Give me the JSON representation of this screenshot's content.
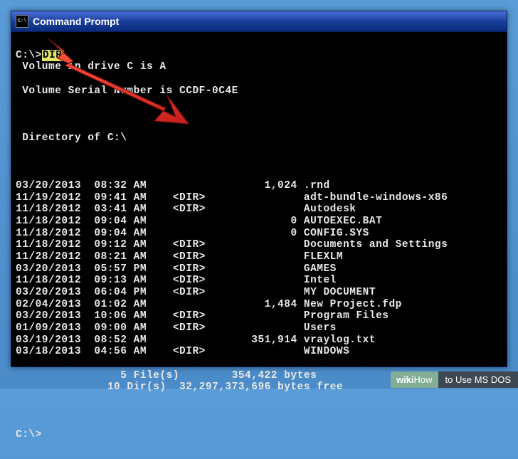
{
  "window": {
    "title": "Command Prompt",
    "icon_label": "C:\\"
  },
  "prompt": "C:\\>",
  "command": "DIR",
  "volume_line": "Volume in drive C is A",
  "serial_line": "Volume Serial Number is CCDF-0C4E",
  "directory_line": "Directory of C:\\",
  "entries": [
    {
      "date": "03/20/2013",
      "time": "08:32 AM",
      "dir": false,
      "size": "1,024",
      "name": ".rnd"
    },
    {
      "date": "11/19/2012",
      "time": "09:41 AM",
      "dir": true,
      "size": "",
      "name": "adt-bundle-windows-x86"
    },
    {
      "date": "11/18/2012",
      "time": "03:41 AM",
      "dir": true,
      "size": "",
      "name": "Autodesk"
    },
    {
      "date": "11/18/2012",
      "time": "09:04 AM",
      "dir": false,
      "size": "0",
      "name": "AUTOEXEC.BAT"
    },
    {
      "date": "11/18/2012",
      "time": "09:04 AM",
      "dir": false,
      "size": "0",
      "name": "CONFIG.SYS"
    },
    {
      "date": "11/18/2012",
      "time": "09:12 AM",
      "dir": true,
      "size": "",
      "name": "Documents and Settings"
    },
    {
      "date": "11/28/2012",
      "time": "08:21 AM",
      "dir": true,
      "size": "",
      "name": "FLEXLM"
    },
    {
      "date": "03/20/2013",
      "time": "05:57 PM",
      "dir": true,
      "size": "",
      "name": "GAMES"
    },
    {
      "date": "11/18/2012",
      "time": "09:13 AM",
      "dir": true,
      "size": "",
      "name": "Intel"
    },
    {
      "date": "03/20/2013",
      "time": "06:04 PM",
      "dir": true,
      "size": "",
      "name": "MY DOCUMENT"
    },
    {
      "date": "02/04/2013",
      "time": "01:02 AM",
      "dir": false,
      "size": "1,484",
      "name": "New Project.fdp"
    },
    {
      "date": "03/20/2013",
      "time": "10:06 AM",
      "dir": true,
      "size": "",
      "name": "Program Files"
    },
    {
      "date": "01/09/2013",
      "time": "09:00 AM",
      "dir": true,
      "size": "",
      "name": "Users"
    },
    {
      "date": "03/19/2013",
      "time": "08:52 AM",
      "dir": false,
      "size": "351,914",
      "name": "vraylog.txt"
    },
    {
      "date": "03/18/2013",
      "time": "04:56 AM",
      "dir": true,
      "size": "",
      "name": "WINDOWS"
    }
  ],
  "summary": {
    "files_count": "5",
    "files_label": "File(s)",
    "files_bytes": "354,422 bytes",
    "dirs_count": "10",
    "dirs_label": "Dir(s)",
    "dirs_bytes": "32,297,373,696 bytes free"
  },
  "end_prompt": "C:\\>",
  "watermark": {
    "brand_bold": "wiki",
    "brand_rest": "How",
    "caption": "to Use MS DOS"
  }
}
